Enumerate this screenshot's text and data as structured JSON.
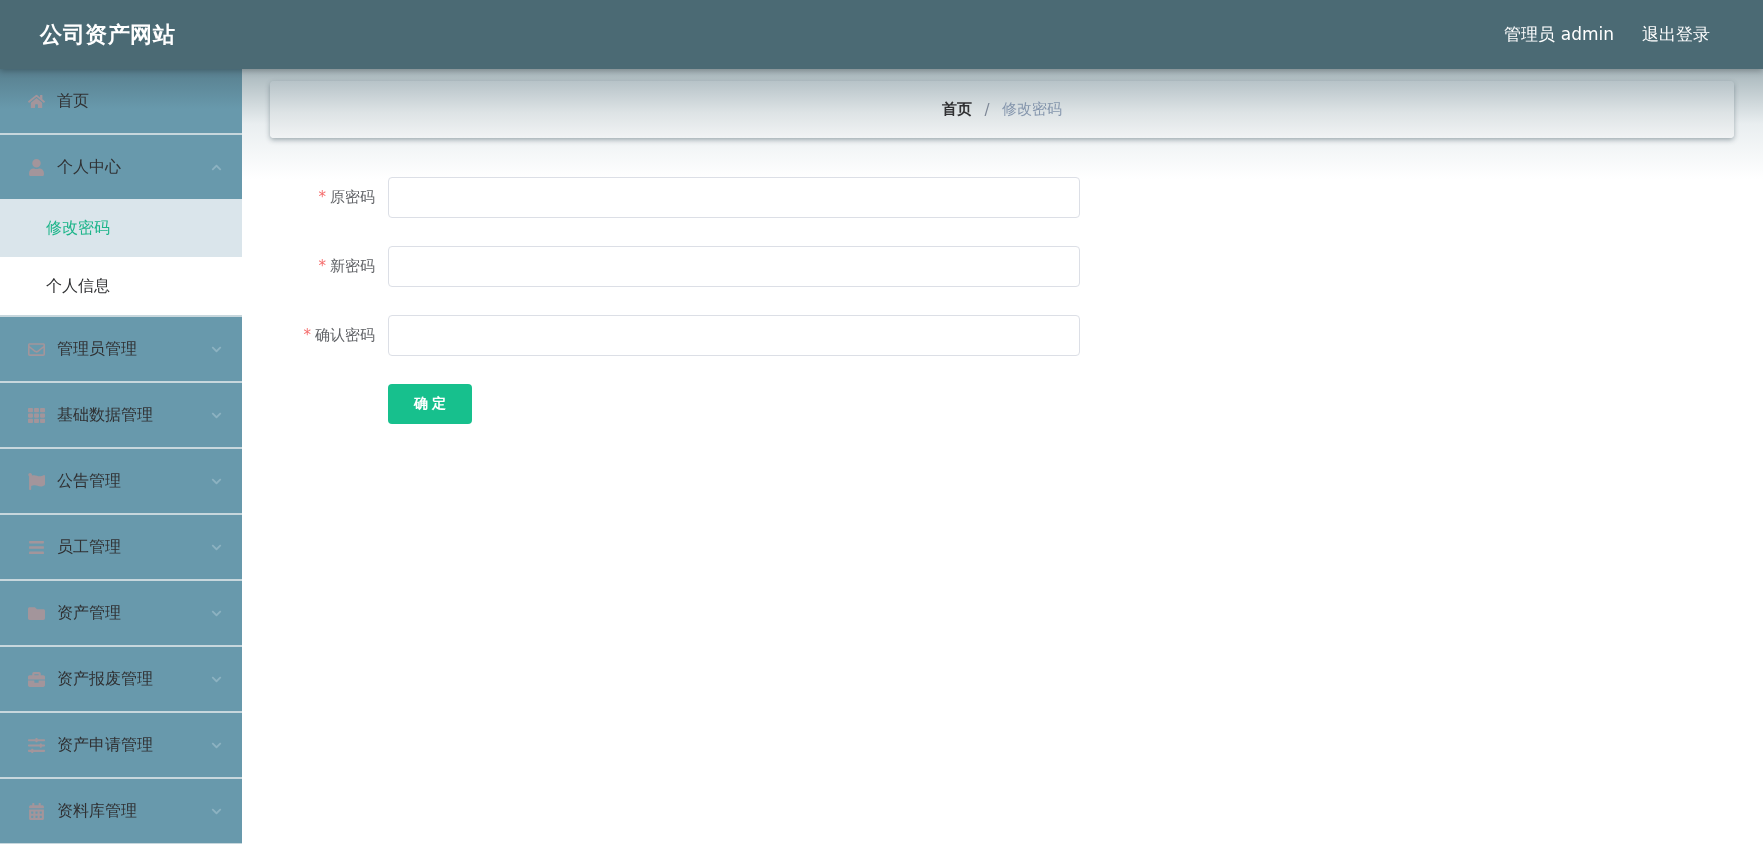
{
  "header": {
    "title": "公司资产网站",
    "user": "管理员 admin",
    "logout": "退出登录"
  },
  "sidebar": {
    "items": [
      {
        "kind": "link",
        "label": "首页",
        "selected": false
      },
      {
        "kind": "menu",
        "label": "个人中心",
        "selected": false,
        "expanded": true,
        "children": [
          {
            "label": "修改密码",
            "selected": true
          },
          {
            "label": "个人信息",
            "selected": false
          }
        ]
      },
      {
        "kind": "menu",
        "label": "管理员管理",
        "selected": false,
        "expanded": false
      },
      {
        "kind": "menu",
        "label": "基础数据管理",
        "selected": false,
        "expanded": false
      },
      {
        "kind": "menu",
        "label": "公告管理",
        "selected": false,
        "expanded": false
      },
      {
        "kind": "menu",
        "label": "员工管理",
        "selected": false,
        "expanded": false
      },
      {
        "kind": "menu",
        "label": "资产管理",
        "selected": false,
        "expanded": false
      },
      {
        "kind": "menu",
        "label": "资产报废管理",
        "selected": false,
        "expanded": false
      },
      {
        "kind": "menu",
        "label": "资产申请管理",
        "selected": false,
        "expanded": false
      },
      {
        "kind": "menu",
        "label": "资料库管理",
        "selected": false,
        "expanded": false
      }
    ]
  },
  "breadcrumb": {
    "separator": "/",
    "items": [
      {
        "label": "首页",
        "current": false
      },
      {
        "label": "修改密码",
        "current": true
      }
    ]
  },
  "form": {
    "required_mark": "*",
    "fields": [
      {
        "label": "原密码",
        "required": true
      },
      {
        "label": "新密码",
        "required": true
      },
      {
        "label": "确认密码",
        "required": true
      }
    ],
    "submit": "确 定"
  }
}
